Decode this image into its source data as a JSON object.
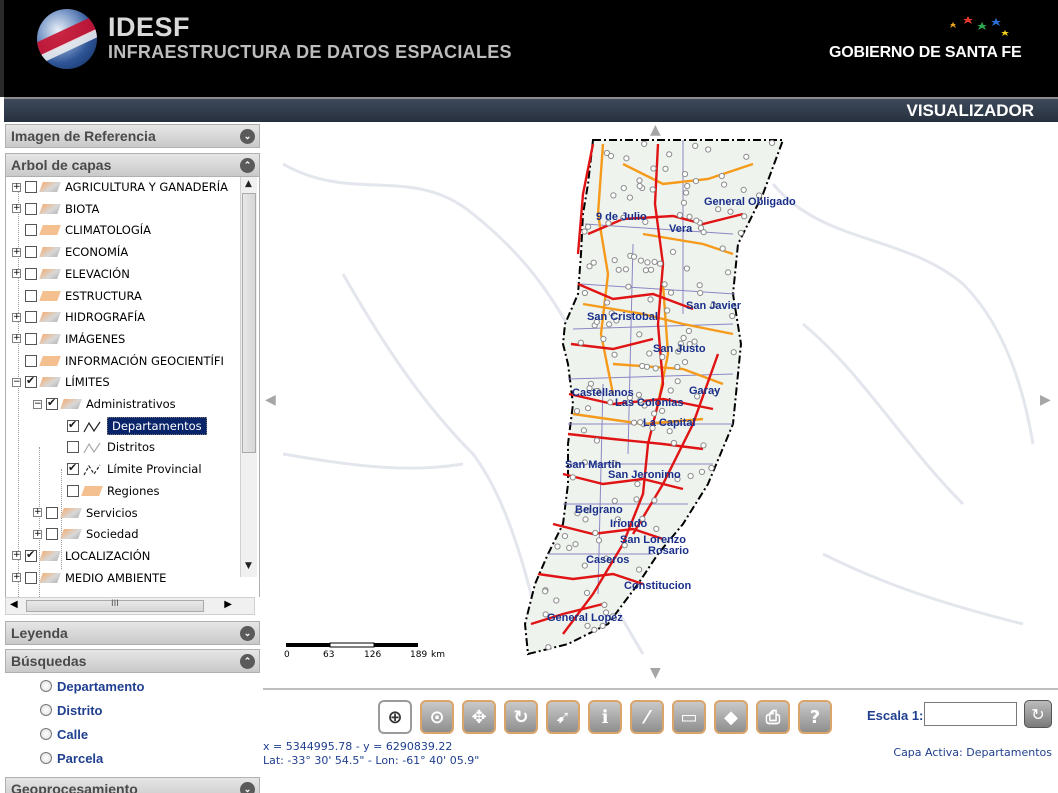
{
  "header": {
    "brand_name": "IDESF",
    "brand_sub": "INFRAESTRUCTURA DE DATOS ESPACIALES",
    "gov_name": "GOBIERNO DE SANTA FE",
    "section_title": "VISUALIZADOR"
  },
  "panels": {
    "reference": "Imagen de Referencia",
    "layers": "Arbol de capas",
    "legend": "Leyenda",
    "search": "Búsquedas",
    "geoprocess": "Geoprocesamiento"
  },
  "tree": [
    {
      "label": "AGRICULTURA Y GANADERÍA",
      "checked": false
    },
    {
      "label": "BIOTA",
      "checked": false
    },
    {
      "label": "CLIMATOLOGÍA",
      "checked": false
    },
    {
      "label": "ECONOMÍA",
      "checked": false
    },
    {
      "label": "ELEVACIÓN",
      "checked": false
    },
    {
      "label": "ESTRUCTURA",
      "checked": false
    },
    {
      "label": "HIDROGRAFÍA",
      "checked": false
    },
    {
      "label": "IMÁGENES",
      "checked": false
    },
    {
      "label": "INFORMACIÓN GEOCIENTÍFI",
      "checked": false
    },
    {
      "label": "LÍMITES",
      "checked": true
    },
    {
      "label": "Administrativos",
      "checked": true
    },
    {
      "label": "Departamentos",
      "checked": true
    },
    {
      "label": "Distritos",
      "checked": false
    },
    {
      "label": "Límite Provincial",
      "checked": true
    },
    {
      "label": "Regiones",
      "checked": false
    },
    {
      "label": "Servicios",
      "checked": false
    },
    {
      "label": "Sociedad",
      "checked": false
    },
    {
      "label": "LOCALIZACIÓN",
      "checked": true
    },
    {
      "label": "MEDIO AMBIENTE",
      "checked": false
    }
  ],
  "hscroll_label": "III",
  "search_options": [
    "Departamento",
    "Distrito",
    "Calle",
    "Parcela"
  ],
  "map": {
    "cities": [
      "General Obligado",
      "9 de Julio",
      "Vera",
      "San Javier",
      "San Cristobal",
      "San Justo",
      "Castellanos",
      "Garay",
      "Las Colonias",
      "La Capital",
      "San Martin",
      "San Jeronimo",
      "Belgrano",
      "Iriondo",
      "San Lorenzo",
      "Rosario",
      "Caseros",
      "Constitucion",
      "General Lopez"
    ],
    "scale_ticks": [
      "0",
      "63",
      "126",
      "189",
      "km"
    ]
  },
  "toolbar": {
    "scale_label": "Escala 1:",
    "scale_value": "",
    "coords_xy": "x = 5344995.78 - y = 6290839.22",
    "coords_latlon": "Lat: -33° 30' 54.5\" - Lon: -61° 40' 05.9\"",
    "active_layer": "Capa Activa: Departamentos",
    "tools": [
      "zoom-to-box",
      "zoom-in",
      "pan",
      "refresh",
      "info-cursor",
      "identify",
      "measure",
      "ruler",
      "polygon",
      "print",
      "help"
    ]
  },
  "colors": {
    "header_bg": "#000000",
    "panel_title": "#4a4a4a",
    "link_blue": "#1f3f8f",
    "road_red": "#e01414",
    "road_orange": "#f59a1a",
    "selection": "#0a246a"
  }
}
